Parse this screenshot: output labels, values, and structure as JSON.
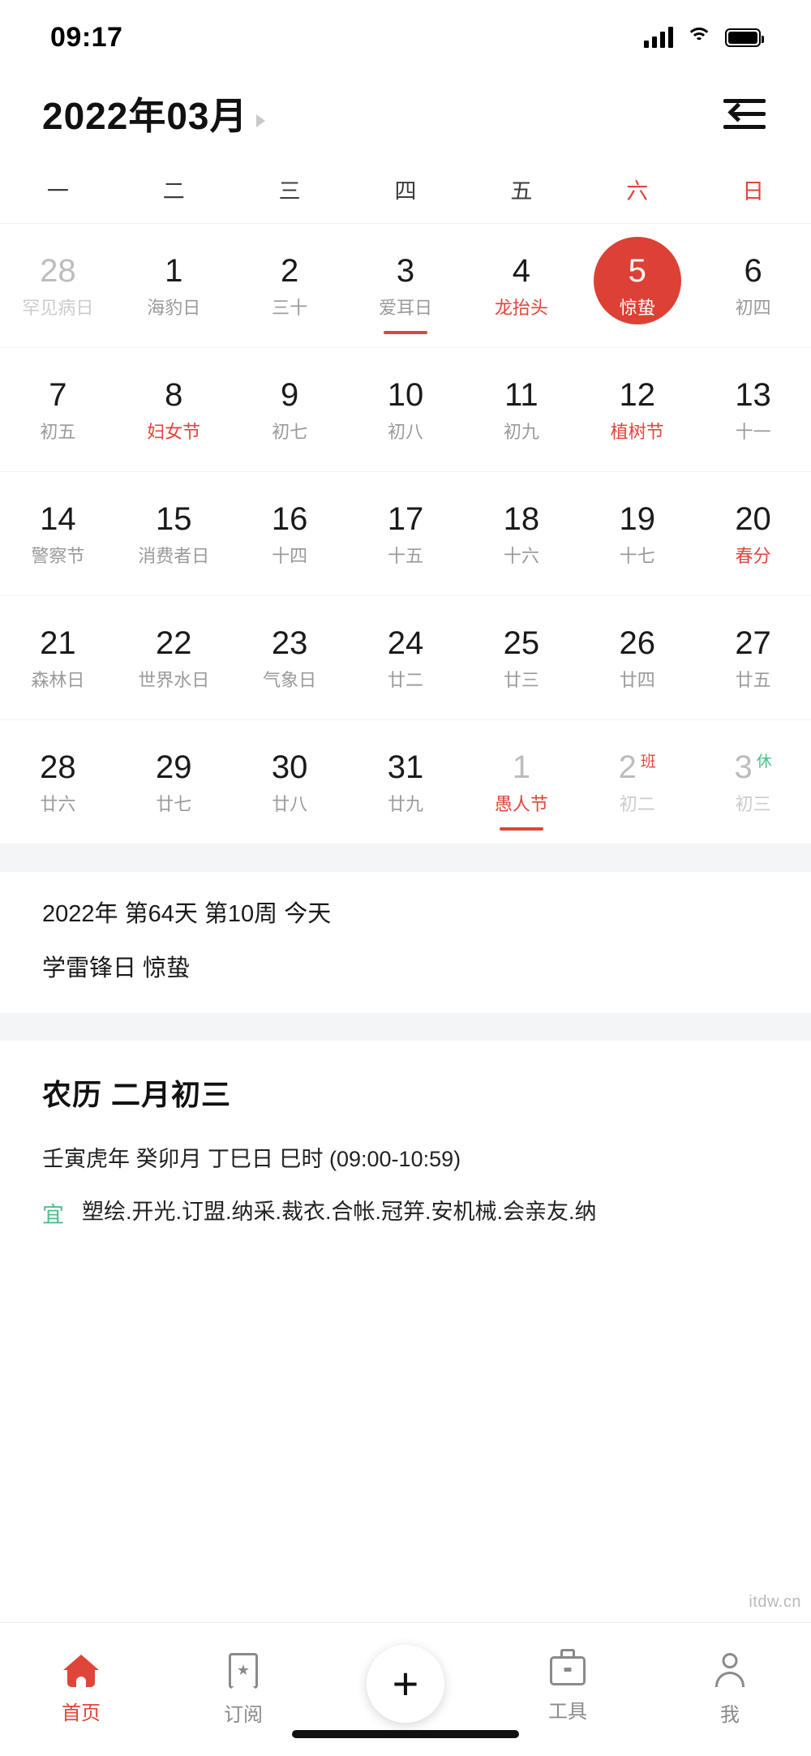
{
  "status_bar": {
    "time": "09:17",
    "icons": [
      "signal-icon",
      "wifi-icon",
      "battery-icon"
    ]
  },
  "header": {
    "month_title": "2022年03月",
    "dropdown_icon": "triangle-right-icon",
    "menu_icon": "collapse-menu-icon"
  },
  "weekdays": [
    {
      "label": "一",
      "weekend": false
    },
    {
      "label": "二",
      "weekend": false
    },
    {
      "label": "三",
      "weekend": false
    },
    {
      "label": "四",
      "weekend": false
    },
    {
      "label": "五",
      "weekend": false
    },
    {
      "label": "六",
      "weekend": true
    },
    {
      "label": "日",
      "weekend": true
    }
  ],
  "calendar": {
    "weeks": [
      [
        {
          "day": "28",
          "sub": "罕见病日",
          "day_style": "muted",
          "sub_style": "muted"
        },
        {
          "day": "1",
          "sub": "海豹日",
          "day_style": "normal",
          "sub_style": "normal"
        },
        {
          "day": "2",
          "sub": "三十",
          "day_style": "normal",
          "sub_style": "normal"
        },
        {
          "day": "3",
          "sub": "爱耳日",
          "day_style": "normal",
          "sub_style": "normal",
          "underline": true
        },
        {
          "day": "4",
          "sub": "龙抬头",
          "day_style": "normal",
          "sub_style": "red"
        },
        {
          "day": "5",
          "sub": "惊蛰",
          "day_style": "selected",
          "sub_style": "white",
          "selected": true
        },
        {
          "day": "6",
          "sub": "初四",
          "day_style": "normal",
          "sub_style": "normal"
        }
      ],
      [
        {
          "day": "7",
          "sub": "初五",
          "day_style": "normal",
          "sub_style": "normal"
        },
        {
          "day": "8",
          "sub": "妇女节",
          "day_style": "normal",
          "sub_style": "red"
        },
        {
          "day": "9",
          "sub": "初七",
          "day_style": "normal",
          "sub_style": "normal"
        },
        {
          "day": "10",
          "sub": "初八",
          "day_style": "normal",
          "sub_style": "normal"
        },
        {
          "day": "11",
          "sub": "初九",
          "day_style": "normal",
          "sub_style": "normal"
        },
        {
          "day": "12",
          "sub": "植树节",
          "day_style": "normal",
          "sub_style": "red"
        },
        {
          "day": "13",
          "sub": "十一",
          "day_style": "normal",
          "sub_style": "normal"
        }
      ],
      [
        {
          "day": "14",
          "sub": "警察节",
          "day_style": "normal",
          "sub_style": "normal"
        },
        {
          "day": "15",
          "sub": "消费者日",
          "day_style": "normal",
          "sub_style": "normal"
        },
        {
          "day": "16",
          "sub": "十四",
          "day_style": "normal",
          "sub_style": "normal"
        },
        {
          "day": "17",
          "sub": "十五",
          "day_style": "normal",
          "sub_style": "normal"
        },
        {
          "day": "18",
          "sub": "十六",
          "day_style": "normal",
          "sub_style": "normal"
        },
        {
          "day": "19",
          "sub": "十七",
          "day_style": "normal",
          "sub_style": "normal"
        },
        {
          "day": "20",
          "sub": "春分",
          "day_style": "normal",
          "sub_style": "red"
        }
      ],
      [
        {
          "day": "21",
          "sub": "森林日",
          "day_style": "normal",
          "sub_style": "normal"
        },
        {
          "day": "22",
          "sub": "世界水日",
          "day_style": "normal",
          "sub_style": "normal"
        },
        {
          "day": "23",
          "sub": "气象日",
          "day_style": "normal",
          "sub_style": "normal"
        },
        {
          "day": "24",
          "sub": "廿二",
          "day_style": "normal",
          "sub_style": "normal"
        },
        {
          "day": "25",
          "sub": "廿三",
          "day_style": "normal",
          "sub_style": "normal"
        },
        {
          "day": "26",
          "sub": "廿四",
          "day_style": "normal",
          "sub_style": "normal"
        },
        {
          "day": "27",
          "sub": "廿五",
          "day_style": "normal",
          "sub_style": "normal"
        }
      ],
      [
        {
          "day": "28",
          "sub": "廿六",
          "day_style": "normal",
          "sub_style": "normal"
        },
        {
          "day": "29",
          "sub": "廿七",
          "day_style": "normal",
          "sub_style": "normal"
        },
        {
          "day": "30",
          "sub": "廿八",
          "day_style": "normal",
          "sub_style": "normal"
        },
        {
          "day": "31",
          "sub": "廿九",
          "day_style": "normal",
          "sub_style": "normal"
        },
        {
          "day": "1",
          "sub": "愚人节",
          "day_style": "muted",
          "sub_style": "red",
          "underline": true
        },
        {
          "day": "2",
          "sub": "初二",
          "day_style": "muted",
          "sub_style": "muted",
          "badge": "班",
          "badge_type": "ban"
        },
        {
          "day": "3",
          "sub": "初三",
          "day_style": "muted",
          "sub_style": "muted",
          "badge": "休",
          "badge_type": "xiu"
        }
      ]
    ]
  },
  "info_panel": {
    "line1": "2022年 第64天 第10周 今天",
    "line2": "学雷锋日   惊蛰"
  },
  "lunar_panel": {
    "title": "农历 二月初三",
    "ganzhi": "壬寅虎年 癸卯月 丁巳日 巳时 (09:00-10:59)",
    "yi_label": "宜",
    "yi_text": "塑绘.开光.订盟.纳采.裁衣.合帐.冠笄.安机械.会亲友.纳"
  },
  "tabbar": {
    "items": [
      {
        "label": "首页",
        "icon": "home-icon",
        "active": true
      },
      {
        "label": "订阅",
        "icon": "bookmark-star-icon",
        "active": false
      },
      {
        "label": "",
        "icon": "plus-icon",
        "active": false
      },
      {
        "label": "工具",
        "icon": "toolbox-icon",
        "active": false
      },
      {
        "label": "我",
        "icon": "person-icon",
        "active": false
      }
    ]
  },
  "watermark": "itdw.cn",
  "colors": {
    "accent_red": "#e0453a",
    "selected_circle": "#dd4034",
    "green": "#4bbf8a",
    "muted": "#bdbdbd",
    "panel_gap": "#f4f5f7"
  }
}
